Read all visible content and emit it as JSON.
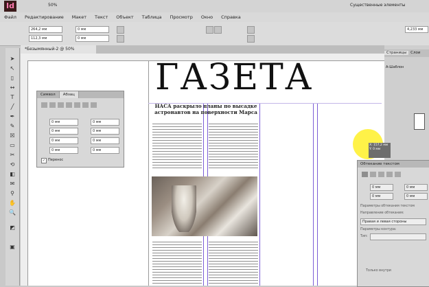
{
  "app": {
    "logo": "Id",
    "zoom": "50%",
    "workspace": "Существенные элементы"
  },
  "menu": [
    "Файл",
    "Редактирование",
    "Макет",
    "Текст",
    "Объект",
    "Таблица",
    "Просмотр",
    "Окно",
    "Справка"
  ],
  "control": {
    "x": "264,2 мм",
    "y": "112,3 мм",
    "w": "0 мм",
    "h": "0 мм",
    "size": "4,233 мм"
  },
  "document": {
    "tab": "*Безымянный-2 @ 50%",
    "masthead": "ГАЗЕТА",
    "headline": "НАСА раскрыло планы по высадке астронавтов на поверхности Марса"
  },
  "para_panel": {
    "tab1": "Символ",
    "tab2": "Абзац",
    "field_value": "0 мм",
    "hyphen": "Перенос"
  },
  "pages_panel": {
    "tab": "Страницы",
    "tab2": "Слои",
    "master": "А-Шаблон"
  },
  "text_wrap_panel": {
    "title": "Обтекание текстом",
    "value": "0 мм",
    "contour": "Параметры обтекания текстом",
    "wrap_to": "Направление обтекания:",
    "wrap_value": "Правая и левая стороны",
    "contour_opts": "Параметры контура:",
    "type": "Тип:",
    "inside": "Только внутри"
  },
  "tooltip": {
    "x": "X: 157,2 мм",
    "y": "Y: 0 мм"
  }
}
